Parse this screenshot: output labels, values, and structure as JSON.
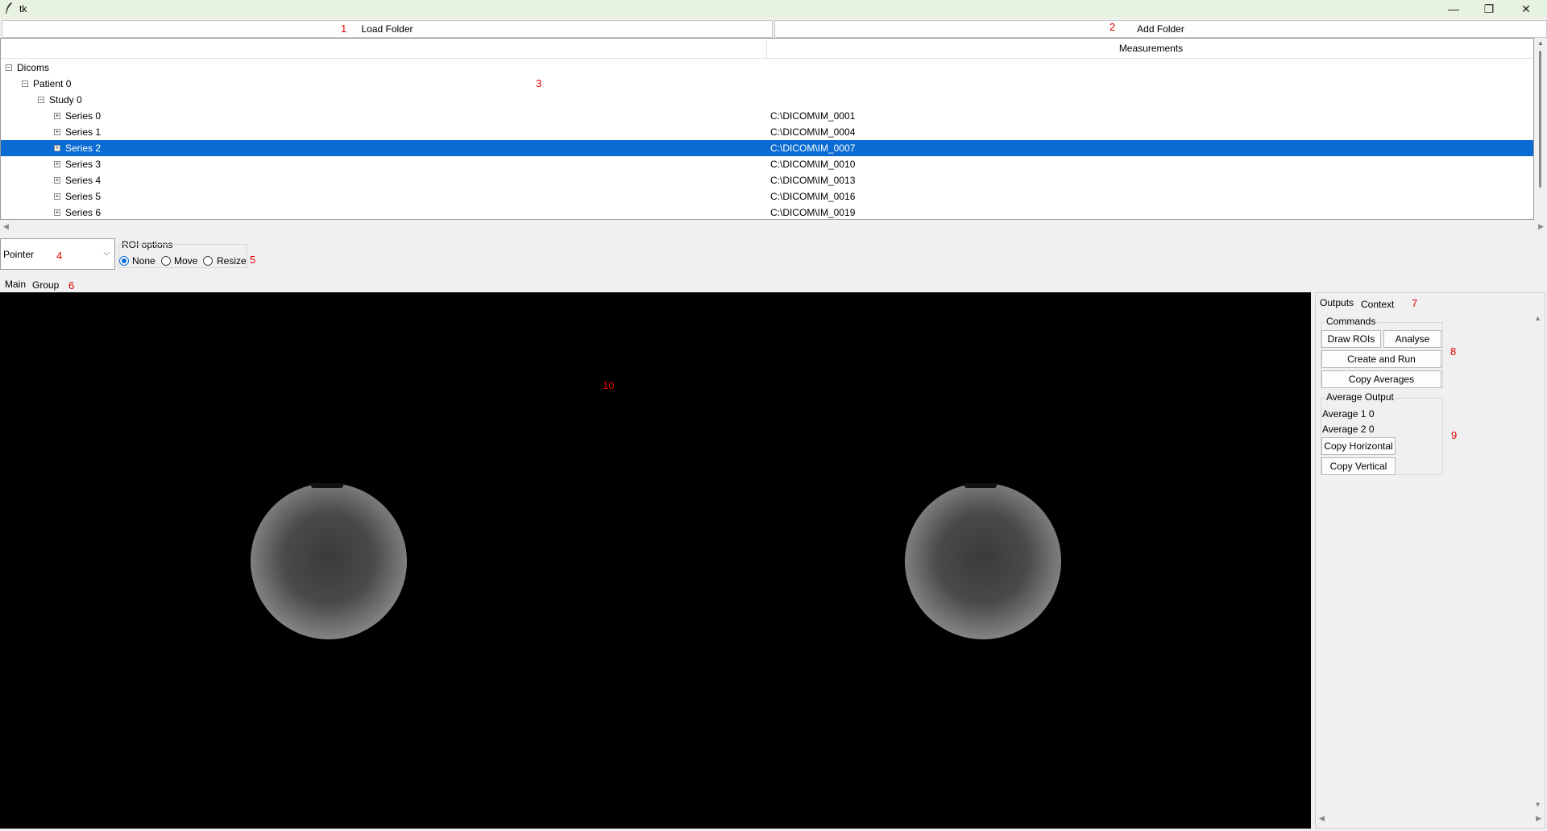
{
  "window": {
    "title": "tk",
    "minimize_glyph": "—",
    "maximize_glyph": "❐",
    "close_glyph": "✕"
  },
  "toolbar": {
    "load_label": "Load Folder",
    "add_label": "Add Folder"
  },
  "tree": {
    "column_header": "Measurements",
    "root": "Dicoms",
    "patient": "Patient 0",
    "study": "Study 0",
    "series": [
      {
        "label": "Series 0",
        "path": "C:\\DICOM\\IM_0001"
      },
      {
        "label": "Series 1",
        "path": "C:\\DICOM\\IM_0004"
      },
      {
        "label": "Series 2",
        "path": "C:\\DICOM\\IM_0007",
        "selected": true
      },
      {
        "label": "Series 3",
        "path": "C:\\DICOM\\IM_0010"
      },
      {
        "label": "Series 4",
        "path": "C:\\DICOM\\IM_0013"
      },
      {
        "label": "Series 5",
        "path": "C:\\DICOM\\IM_0016"
      },
      {
        "label": "Series 6",
        "path": "C:\\DICOM\\IM_0019"
      }
    ]
  },
  "tool_select": {
    "value": "Pointer"
  },
  "roi_options": {
    "title": "ROI options",
    "options": [
      "None",
      "Move",
      "Resize"
    ],
    "selected": "None"
  },
  "view_tabs": [
    "Main",
    "Group"
  ],
  "right_tabs": [
    "Outputs",
    "Context"
  ],
  "commands": {
    "title": "Commands",
    "draw_rois": "Draw ROIs",
    "analyse": "Analyse",
    "create_run": "Create and Run",
    "copy_averages": "Copy Averages"
  },
  "average_output": {
    "title": "Average Output",
    "avg1": "Average 1 0",
    "avg2": "Average 2 0",
    "copy_horizontal": "Copy Horizontal",
    "copy_vertical": "Copy Vertical"
  },
  "annotations": [
    "1",
    "2",
    "3",
    "4",
    "5",
    "6",
    "7",
    "8",
    "9",
    "10"
  ],
  "colors": {
    "selection": "#0a6cd2",
    "annotation": "#e00000",
    "canvas": "#000000"
  }
}
